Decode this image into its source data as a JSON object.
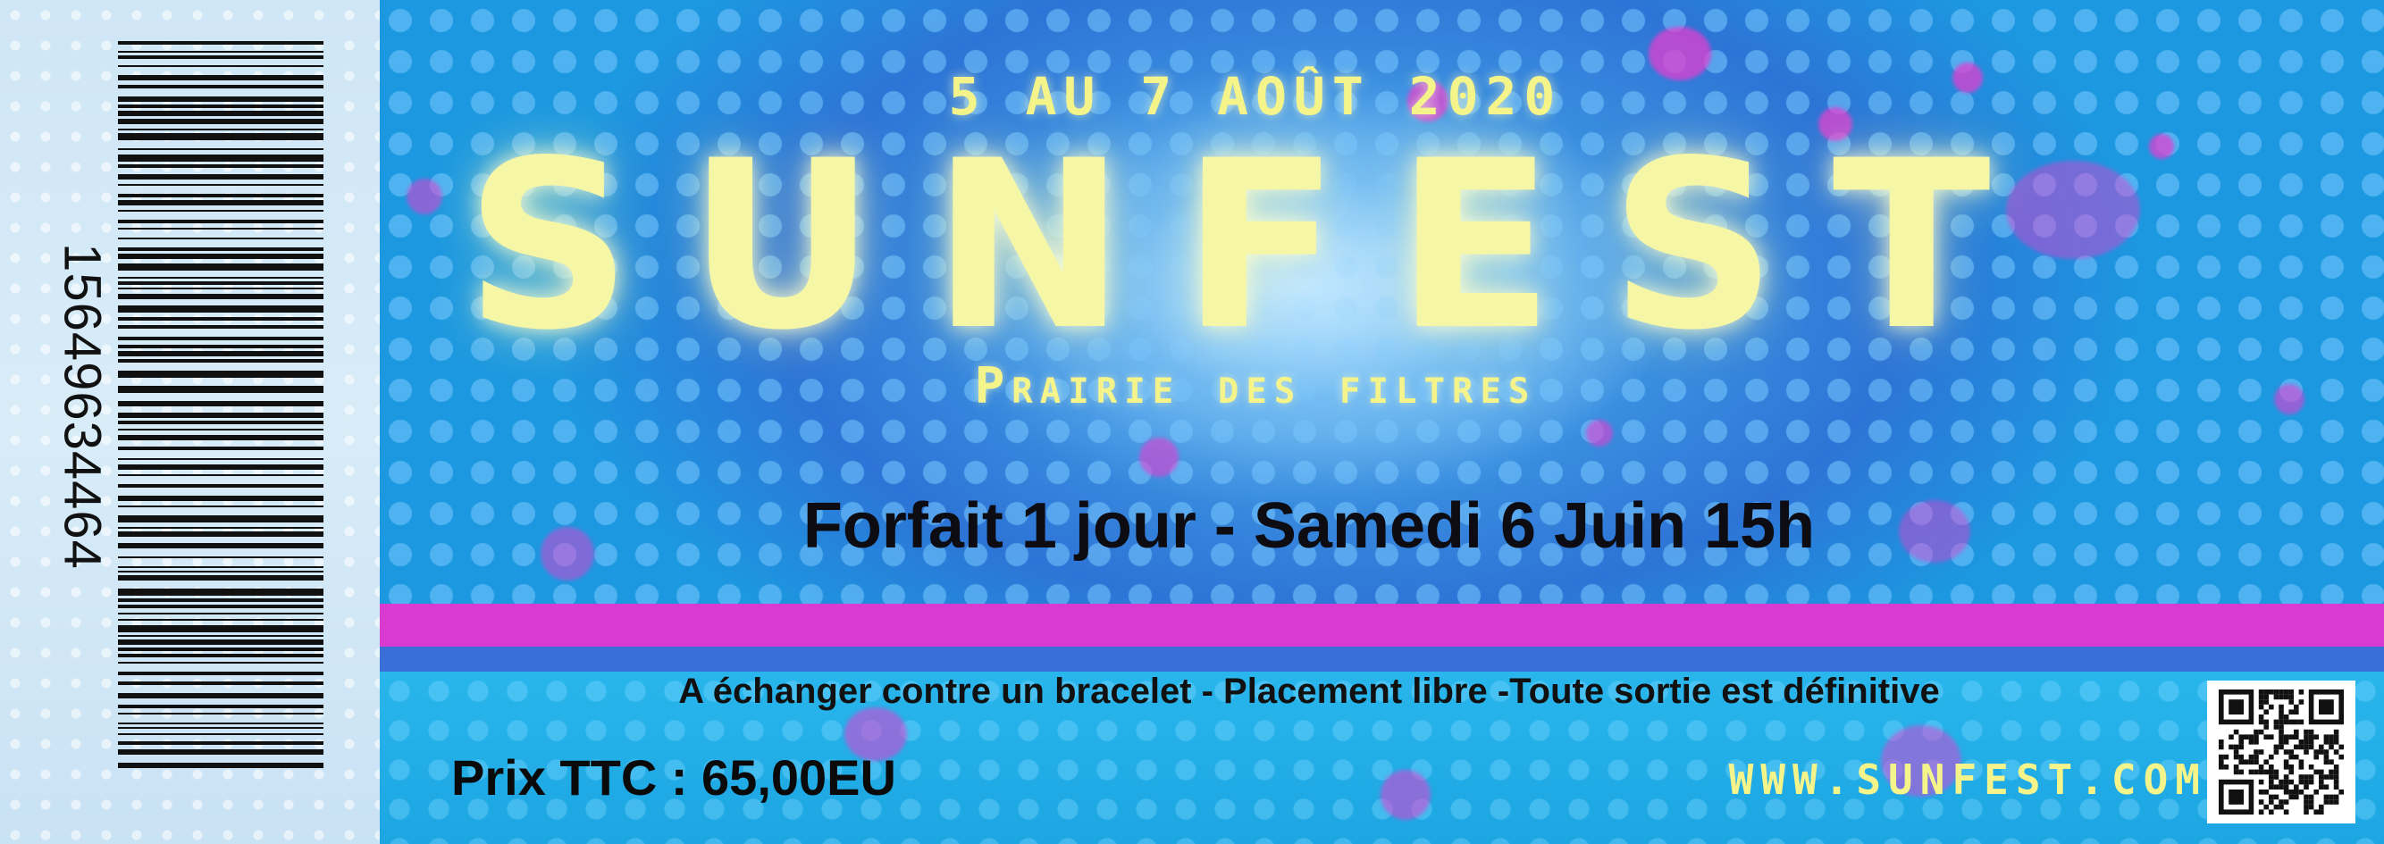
{
  "ticket": {
    "barcode_number": "15649634464",
    "dates": "5 AU 7 AOÛT 2020",
    "title": "SUNFEST",
    "venue": "Prairie des filtres",
    "pass": "Forfait 1 jour - Samedi 6 Juin 15h",
    "conditions": "A échanger contre un bracelet - Placement libre -Toute sortie est définitive",
    "price": "Prix TTC : 65,00EU",
    "website": "WWW.SUNFEST.COM"
  },
  "colors": {
    "accent_yellow": "#f4f48a",
    "band_pink": "#d93ad0",
    "band_blue": "#3a6fd8",
    "background_blue": "#2aa8e0"
  },
  "icons": [
    "barcode-icon",
    "qr-code-icon"
  ]
}
